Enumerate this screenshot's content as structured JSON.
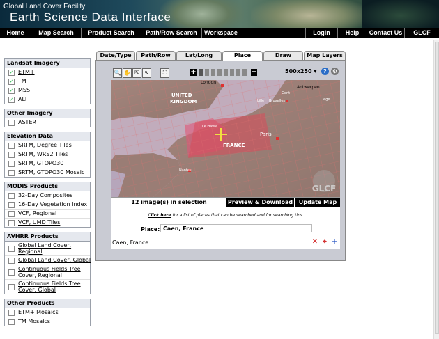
{
  "header": {
    "org": "Global Land Cover Facility",
    "title": "Earth Science Data Interface"
  },
  "nav": {
    "left": [
      "Home",
      "Map Search",
      "Product Search",
      "Path/Row Search",
      "Workspace"
    ],
    "right": [
      "Login",
      "Help",
      "Contact Us",
      "GLCF"
    ]
  },
  "sidebar": {
    "groups": [
      {
        "title": "Landsat Imagery",
        "items": [
          {
            "label": "ETM+",
            "checked": true
          },
          {
            "label": "TM",
            "checked": true
          },
          {
            "label": "MSS",
            "checked": true
          },
          {
            "label": "ALI",
            "checked": true
          }
        ]
      },
      {
        "title": "Other Imagery",
        "items": [
          {
            "label": "ASTER",
            "checked": false
          }
        ]
      },
      {
        "title": "Elevation Data",
        "items": [
          {
            "label": "SRTM, Degree Tiles",
            "checked": false
          },
          {
            "label": "SRTM, WRS2 Tiles",
            "checked": false
          },
          {
            "label": "SRTM, GTOPO30",
            "checked": false
          },
          {
            "label": "SRTM, GTOPO30 Mosaic",
            "checked": false
          }
        ]
      },
      {
        "title": "MODIS Products",
        "items": [
          {
            "label": "32-Day Composites",
            "checked": false
          },
          {
            "label": "16-Day Vegetation Index",
            "checked": false
          },
          {
            "label": "VCF, Regional",
            "checked": false
          },
          {
            "label": "VCF, UMD Tiles",
            "checked": false
          }
        ]
      },
      {
        "title": "AVHRR Products",
        "items": [
          {
            "label": "Global Land Cover, Regional",
            "checked": false
          },
          {
            "label": "Global Land Cover, Global",
            "checked": false
          },
          {
            "label": "Continuous Fields Tree Cover, Regional",
            "checked": false
          },
          {
            "label": "Continuous Fields Tree Cover, Global",
            "checked": false
          }
        ]
      },
      {
        "title": "Other Products",
        "items": [
          {
            "label": "ETM+ Mosaics",
            "checked": false
          },
          {
            "label": "TM Mosaics",
            "checked": false
          }
        ]
      }
    ]
  },
  "tabs": [
    "Date/Type",
    "Path/Row",
    "Lat/Long",
    "Place",
    "Draw",
    "Map Layers"
  ],
  "active_tab": "Place",
  "toolbar": {
    "size_value": "500x250",
    "zoom_in_icon": "zoom-in",
    "zoom_out_icon": "zoom-out"
  },
  "map": {
    "labels": {
      "london": "London",
      "antwerpen": "Antwerpen",
      "uk1": "UNITED",
      "uk2": "KINGDOM",
      "lille": "Lille",
      "brussel": "Bruxelles",
      "liege": "Liege",
      "oent": "Gent",
      "lehavre": "Le Havre",
      "paris": "Paris",
      "france": "FRANCE",
      "nantes": "Nantes",
      "watermark": "GLCF"
    }
  },
  "status": {
    "selection": "12 image(s) in selection",
    "preview_button": "Preview & Download",
    "update_button": "Update Map"
  },
  "place_search": {
    "hint_link": "Click here",
    "hint_text": " for a list of places that can be searched and for searching tips.",
    "label": "Place:",
    "value": "Caen, France"
  },
  "result": {
    "text": "Caen, France"
  }
}
